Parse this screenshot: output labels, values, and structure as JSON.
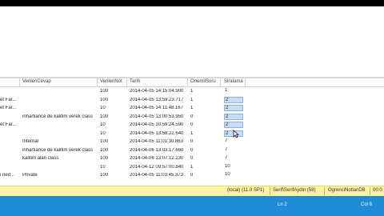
{
  "grid": {
    "columns": [
      "VerilenCevap",
      "VerilenNot",
      "Tarih",
      "OnemliSoru",
      "Siralama"
    ],
    "rows": [
      {
        "prefix": "",
        "cevap": "",
        "not": "100",
        "tarih": "2014-04-05 14:15:04.900",
        "onemli": "1",
        "siralama": "1",
        "selected": false
      },
      {
        "prefix": "et Far...",
        "cevap": "",
        "not": "100",
        "tarih": "2014-04-05 13:59:23.717",
        "onemli": "1",
        "siralama": "2",
        "selected": true
      },
      {
        "prefix": "et Far...",
        "cevap": "",
        "not": "10",
        "tarih": "2014-04-05 14:11:48.167",
        "onemli": "1",
        "siralama": "2",
        "selected": true
      },
      {
        "prefix": "",
        "cevap": "inhartiance de kalitim verek class",
        "not": "100",
        "tarih": "2014-04-05 13:00:53.950",
        "onemli": "0",
        "siralama": "2",
        "selected": true
      },
      {
        "prefix": "et Far...",
        "cevap": "",
        "not": "10",
        "tarih": "2014-04-05 10:59:24.590",
        "onemli": "0",
        "siralama": "2",
        "selected": true
      },
      {
        "prefix": "",
        "cevap": "",
        "not": "10",
        "tarih": "2014-04-05 13:58:22.640",
        "onemli": "1",
        "siralama": "2",
        "selected": true
      },
      {
        "prefix": "",
        "cevap": "Internal",
        "not": "100",
        "tarih": "2014-04-05 11:01:30.863",
        "onemli": "0",
        "siralama": "7",
        "selected": false
      },
      {
        "prefix": "",
        "cevap": "inhartiance de kalitim verek class",
        "not": "100",
        "tarih": "2014-04-06 13:03:17.660",
        "onemli": "0",
        "siralama": "7",
        "selected": false
      },
      {
        "prefix": "",
        "cevap": "kalitim alan class",
        "not": "100",
        "tarih": "2014-04-06 13:07:12.230",
        "onemli": "0",
        "siralama": "7",
        "selected": false
      },
      {
        "prefix": "",
        "cevap": "",
        "not": "10",
        "tarih": "2014-04-12 09:57:00.840",
        "onemli": "1",
        "siralama": "10",
        "selected": false
      },
      {
        "prefix": "i ned...",
        "cevap": "Private",
        "not": "100",
        "tarih": "2014-04-05 11:03:45.373",
        "onemli": "0",
        "siralama": "10",
        "selected": false
      }
    ]
  },
  "status": {
    "server": "(local) (11.0 SP1)",
    "user": "Serif\\SerifAydin (58)",
    "database": "OgrenciNotlariDB",
    "time": "00:0"
  },
  "bottom": {
    "line": "Ln 2",
    "col": "Col 8"
  },
  "colors": {
    "status_bg": "#fff3a0",
    "bottom_bg": "#1e8bd6",
    "selection": "#c7dcf5"
  }
}
